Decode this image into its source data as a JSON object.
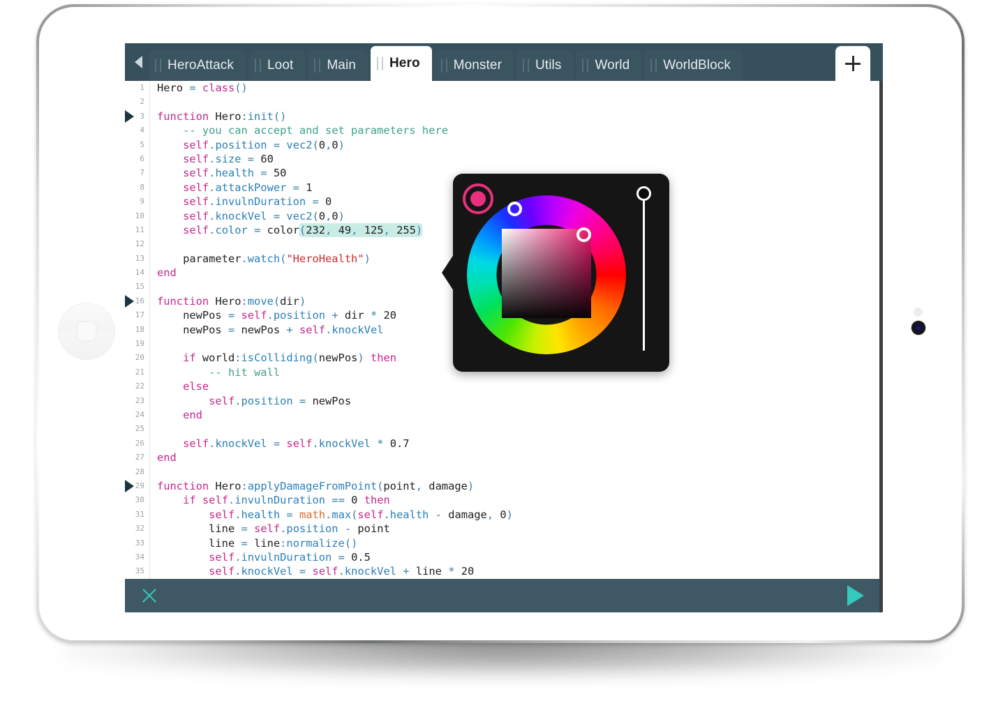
{
  "app": {
    "title": "Codea Editor",
    "accent_teal": "#34c9bc",
    "chrome_color": "#36505c",
    "active_tab": "Hero"
  },
  "tabbar": {
    "scroll_left_icon": "chevron-left-icon",
    "add_tab_icon": "plus-icon",
    "tabs": [
      {
        "label": "HeroAttack",
        "active": false
      },
      {
        "label": "Loot",
        "active": false
      },
      {
        "label": "Main",
        "active": false
      },
      {
        "label": "Hero",
        "active": true
      },
      {
        "label": "Monster",
        "active": false
      },
      {
        "label": "Utils",
        "active": false
      },
      {
        "label": "World",
        "active": false
      },
      {
        "label": "WorldBlock",
        "active": false
      }
    ]
  },
  "editor": {
    "language": "lua",
    "selection_text": "(232, 49, 125, 255)",
    "fold_marker_lines": [
      3,
      16,
      29
    ],
    "lines": [
      {
        "n": 1,
        "text": "Hero = class()"
      },
      {
        "n": 2,
        "text": ""
      },
      {
        "n": 3,
        "text": "function Hero:init()"
      },
      {
        "n": 4,
        "text": "    -- you can accept and set parameters here"
      },
      {
        "n": 5,
        "text": "    self.position = vec2(0,0)"
      },
      {
        "n": 6,
        "text": "    self.size = 60"
      },
      {
        "n": 7,
        "text": "    self.health = 50"
      },
      {
        "n": 8,
        "text": "    self.attackPower = 1"
      },
      {
        "n": 9,
        "text": "    self.invulnDuration = 0"
      },
      {
        "n": 10,
        "text": "    self.knockVel = vec2(0,0)"
      },
      {
        "n": 11,
        "text": "    self.color = color(232, 49, 125, 255)"
      },
      {
        "n": 12,
        "text": ""
      },
      {
        "n": 13,
        "text": "    parameter.watch(\"HeroHealth\")"
      },
      {
        "n": 14,
        "text": "end"
      },
      {
        "n": 15,
        "text": ""
      },
      {
        "n": 16,
        "text": "function Hero:move(dir)"
      },
      {
        "n": 17,
        "text": "    newPos = self.position + dir * 20"
      },
      {
        "n": 18,
        "text": "    newPos = newPos + self.knockVel"
      },
      {
        "n": 19,
        "text": ""
      },
      {
        "n": 20,
        "text": "    if world:isColliding(newPos) then"
      },
      {
        "n": 21,
        "text": "        -- hit wall"
      },
      {
        "n": 22,
        "text": "    else"
      },
      {
        "n": 23,
        "text": "        self.position = newPos"
      },
      {
        "n": 24,
        "text": "    end"
      },
      {
        "n": 25,
        "text": ""
      },
      {
        "n": 26,
        "text": "    self.knockVel = self.knockVel * 0.7"
      },
      {
        "n": 27,
        "text": "end"
      },
      {
        "n": 28,
        "text": ""
      },
      {
        "n": 29,
        "text": "function Hero:applyDamageFromPoint(point, damage)"
      },
      {
        "n": 30,
        "text": "    if self.invulnDuration == 0 then"
      },
      {
        "n": 31,
        "text": "        self.health = math.max(self.health - damage, 0)"
      },
      {
        "n": 32,
        "text": "        line = self.position - point"
      },
      {
        "n": 33,
        "text": "        line = line:normalize()"
      },
      {
        "n": 34,
        "text": "        self.invulnDuration = 0.5"
      },
      {
        "n": 35,
        "text": "        self.knockVel = self.knockVel + line * 20"
      }
    ]
  },
  "color_picker": {
    "name": "color-picker-popover",
    "current_color_hex": "#e8317d",
    "rgba": {
      "r": 232,
      "g": 49,
      "b": 125,
      "a": 255
    },
    "swatch_icon": "color-swatch-icon",
    "hue_ring_handle": "hue-handle",
    "sv_square_handle": "saturation-value-handle",
    "alpha_slider_handle": "alpha-slider-handle"
  },
  "bottombar": {
    "close_icon": "close-icon",
    "run_icon": "play-icon"
  },
  "device": {
    "home_button_icon": "home-button-icon",
    "camera_icon": "camera-icon",
    "sensor_icon": "ambient-light-sensor-icon"
  }
}
